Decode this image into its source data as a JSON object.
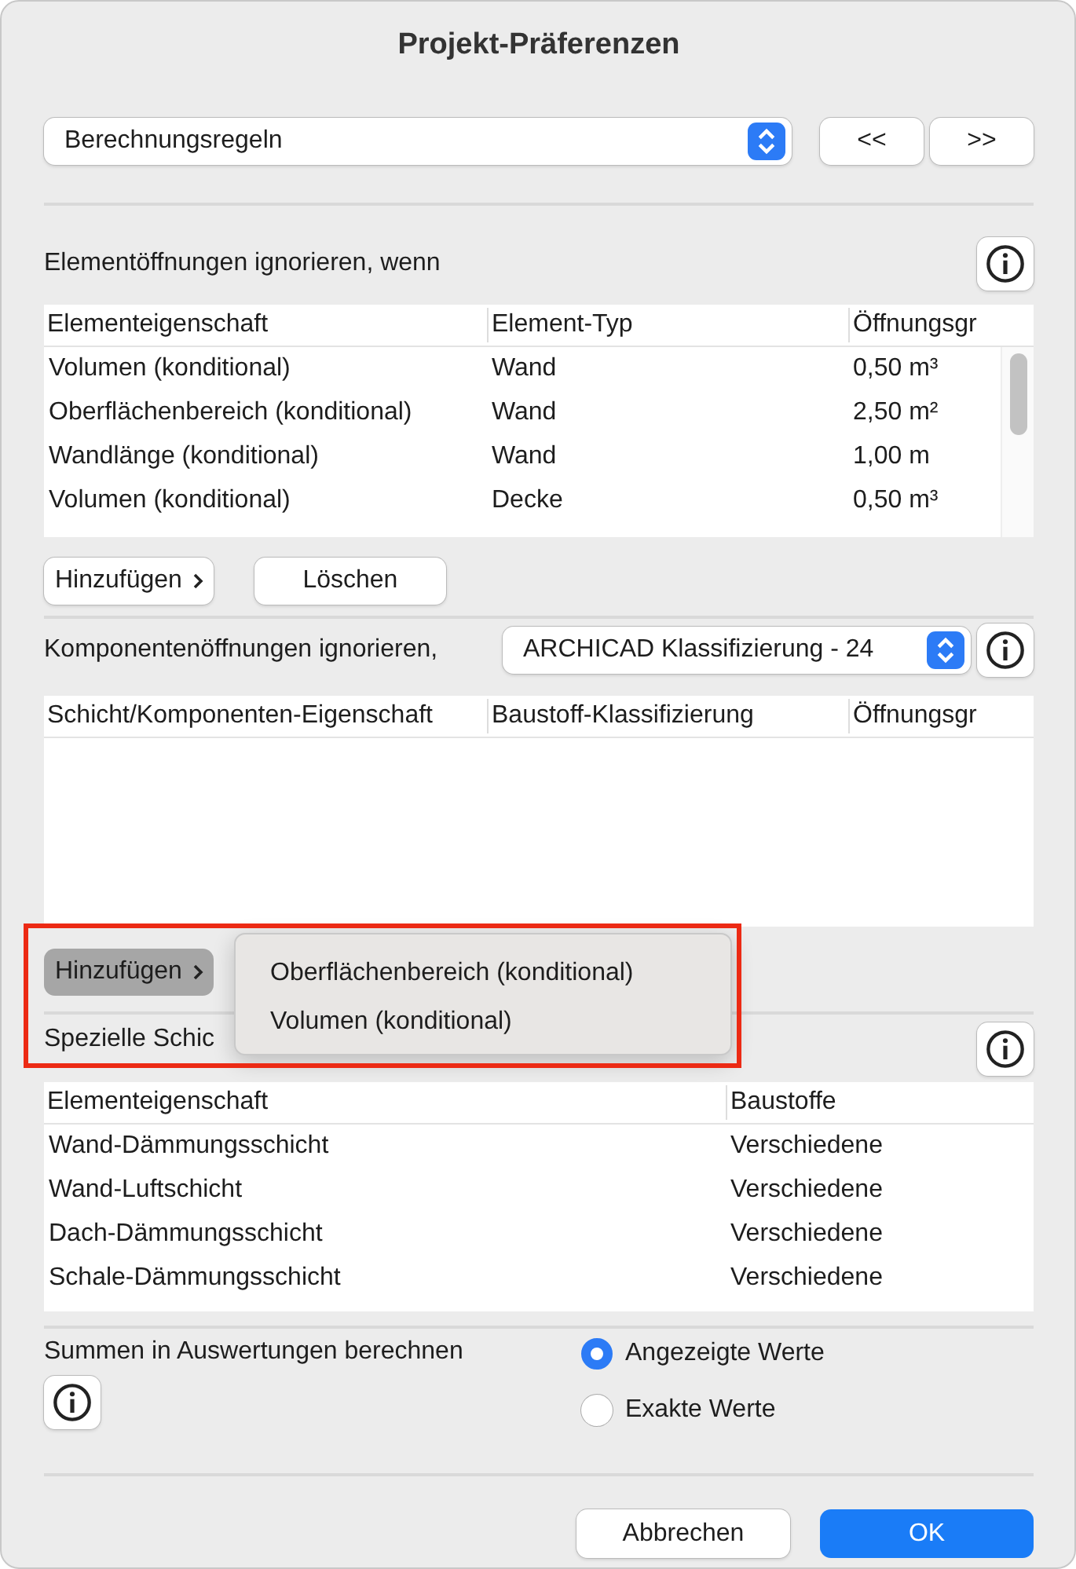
{
  "window": {
    "title": "Projekt-Präferenzen"
  },
  "header": {
    "dropdown": "Berechnungsregeln",
    "nav_buttons": [
      "<<",
      ">>"
    ]
  },
  "element_openings": {
    "label": "Elementöffnungen ignorieren, wenn",
    "columns": [
      "Elementeigenschaft",
      "Element-Typ",
      "Öffnungsgr"
    ],
    "rows": [
      [
        "Volumen (konditional)",
        "Wand",
        "0,50 m³"
      ],
      [
        "Oberflächenbereich (konditional)",
        "Wand",
        "2,50 m²"
      ],
      [
        "Wandlänge (konditional)",
        "Wand",
        "1,00 m"
      ],
      [
        "Volumen (konditional)",
        "Decke",
        "0,50 m³"
      ]
    ],
    "buttons": [
      {
        "label": "Hinzufügen",
        "kind": "menu",
        "pressed": false
      },
      {
        "label": "Löschen",
        "kind": "plain",
        "pressed": false
      }
    ]
  },
  "component_openings": {
    "label": "Komponentenöffnungen ignorieren,",
    "dropdown": "ARCHICAD Klassifizierung - 24",
    "columns": [
      "Schicht/Komponenten-Eigenschaft",
      "Baustoff-Klassifizierung",
      "Öffnungsgr"
    ],
    "add_button": {
      "label": "Hinzufügen",
      "pressed": true
    },
    "menu": {
      "items": [
        "Oberflächenbereich (konditional)",
        "Volumen (konditional)"
      ]
    }
  },
  "special_layers": {
    "label": "Spezielle Schic",
    "columns": [
      "Elementeigenschaft",
      "Baustoffe"
    ],
    "rows": [
      [
        "Wand-Dämmungsschicht",
        "Verschiedene"
      ],
      [
        "Wand-Luftschicht",
        "Verschiedene"
      ],
      [
        "Dach-Dämmungsschicht",
        "Verschiedene"
      ],
      [
        "Schale-Dämmungsschicht",
        "Verschiedene"
      ]
    ]
  },
  "sums": {
    "label": "Summen in Auswertungen berechnen",
    "options": [
      {
        "label": "Angezeigte Werte",
        "selected": true
      },
      {
        "label": "Exakte Werte",
        "selected": false
      }
    ]
  },
  "footer": {
    "buttons": [
      {
        "label": "Abbrechen",
        "kind": "secondary"
      },
      {
        "label": "OK",
        "kind": "primary"
      }
    ]
  }
}
